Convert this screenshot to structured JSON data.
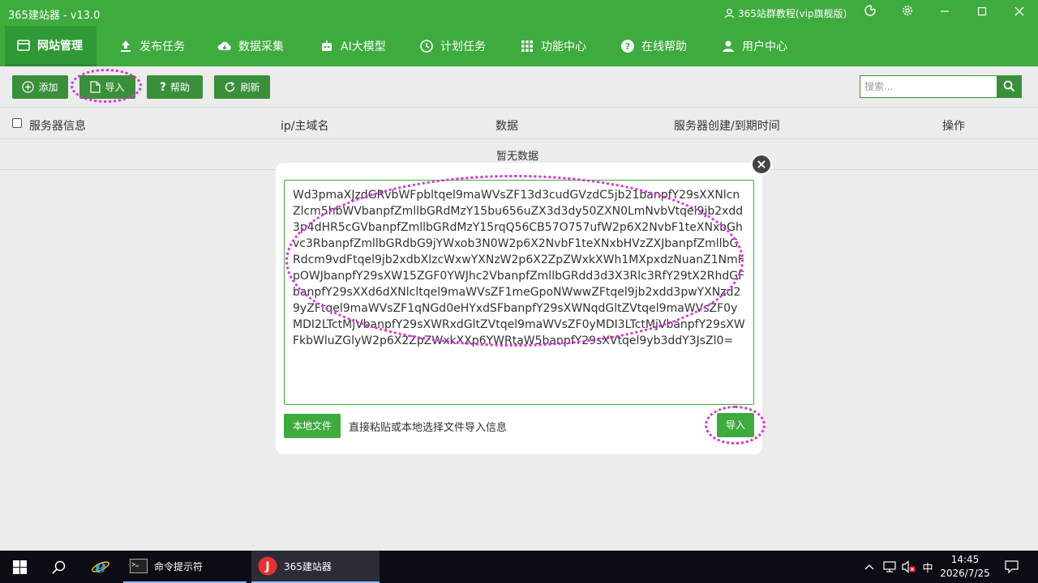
{
  "window": {
    "title": "365建站器 - v13.0",
    "tutorial_label": "365站群教程(vip旗舰版)"
  },
  "nav": {
    "items": [
      {
        "label": "网站管理",
        "icon": "window-icon",
        "active": true
      },
      {
        "label": "发布任务",
        "icon": "upload-icon"
      },
      {
        "label": "数据采集",
        "icon": "cloud-download-icon"
      },
      {
        "label": "AI大模型",
        "icon": "robot-icon"
      },
      {
        "label": "计划任务",
        "icon": "clock-icon"
      },
      {
        "label": "功能中心",
        "icon": "grid-icon"
      },
      {
        "label": "在线帮助",
        "icon": "help-icon"
      },
      {
        "label": "用户中心",
        "icon": "user-icon"
      }
    ]
  },
  "toolbar": {
    "add": "添加",
    "import": "导入",
    "help": "帮助",
    "refresh": "刷新",
    "search_placeholder": "搜索..."
  },
  "table": {
    "headers": [
      "服务器信息",
      "ip/主域名",
      "数据",
      "服务器创建/到期时间",
      "操作"
    ],
    "empty_text": "暂无数据"
  },
  "dialog": {
    "textarea_value": "Wd3pmaXJzdGRvbWFpbltqel9maWVsZF13d3cudGVzdC5jb21banpfY29sXXNlcnZlcm5hbWVbanpfZmllbGRdMzY15bu656uZX3d3dy50ZXN0LmNvbVtqel9jb2xdd3p4dHR5cGVbanpfZmllbGRdMzY15rqQ56CB57O757ufW2p6X2NvbF1teXNxbGhvc3RbanpfZmllbGRdbG9jYWxob3N0W2p6X2NvbF1teXNxbHVzZXJbanpfZmllbGRdcm9vdFtqel9jb2xdbXlzcWxwYXNzW2p6X2ZpZWxkXWh1MXpxdzNuanZ1NmFpOWJbanpfY29sXW15ZGF0YWJhc2VbanpfZmllbGRdd3d3X3Rlc3RfY29tX2RhdGFbanpfY29sXXd6dXNlcltqel9maWVsZF1meGpoNWwwZFtqel9jb2xdd3pwYXNzd29yZFtqel9maWVsZF1qNGd0eHYxdSFbanpfY29sXWNqdGltZVtqel9maWVsZF0yMDI2LTctMjVbanpfY29sXWRxdGltZVtqel9maWVsZF0yMDI3LTctMjVbanpfY29sXWFkbWluZGlyW2p6X2ZpZWxkXXp6YWRtaW5banpfY29sXVtqel9yb3ddY3JsZl0=",
    "local_file_button": "本地文件",
    "hint": "直接粘贴或本地选择文件导入信息",
    "import_button": "导入"
  },
  "taskbar": {
    "apps": [
      {
        "label": "命令提示符",
        "icon": "cmd-icon"
      },
      {
        "label": "365建站器",
        "icon": "365-app-icon",
        "active": true
      }
    ],
    "ime": "中",
    "time": "14:45",
    "date": "2026/7/25"
  },
  "colors": {
    "brand_green": "#3eab3e",
    "dark_green": "#3a8f3a",
    "annotation_magenta": "#e02ee0",
    "taskbar": "#0c0c14"
  }
}
